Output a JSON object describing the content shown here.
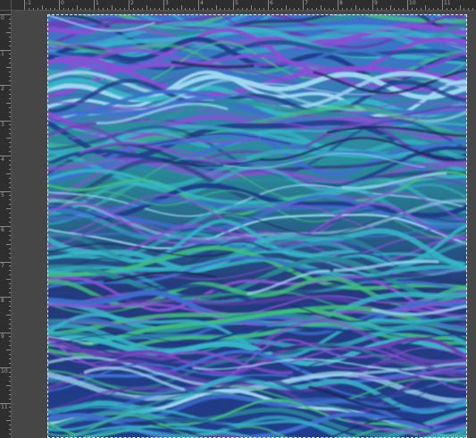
{
  "ruler": {
    "top_labels": [
      "-1",
      "0",
      "1",
      "2",
      "3",
      "4",
      "5",
      "6",
      "7",
      "8",
      "9",
      "10",
      "11",
      "12"
    ],
    "left_labels": [
      "0",
      "1",
      "2",
      "3",
      "4",
      "5",
      "6",
      "7",
      "8",
      "9",
      "10",
      "11"
    ]
  },
  "document": {
    "palette": {
      "deep": "#1f3d8c",
      "navy": "#243a7a",
      "blue": "#3f6fd0",
      "cyan": "#35b8c8",
      "teal": "#2a8f9a",
      "violet": "#8a4fd6",
      "purple": "#6a3fb4",
      "green": "#3fc07a",
      "light": "#9fd8f0"
    }
  }
}
